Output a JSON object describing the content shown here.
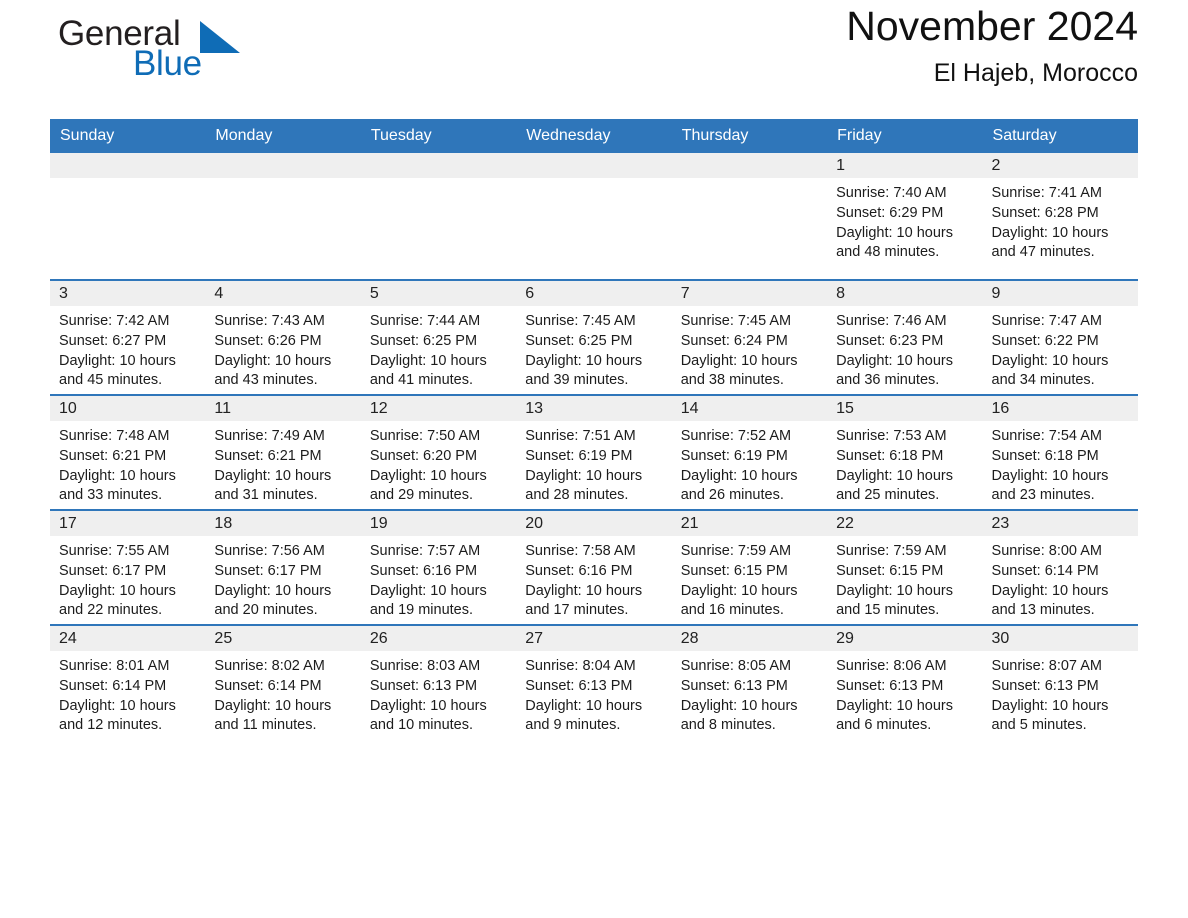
{
  "brand": {
    "name_part1": "General",
    "name_part2": "Blue",
    "flag_icon": "triangle-flag-icon",
    "accent_color": "#0f6cb6"
  },
  "header": {
    "title": "November 2024",
    "subtitle": "El Hajeb, Morocco"
  },
  "theme": {
    "header_bg": "#2f76ba",
    "daynum_bg": "#efefef",
    "text": "#1c1c1c"
  },
  "calendar": {
    "weekday_headers": [
      "Sunday",
      "Monday",
      "Tuesday",
      "Wednesday",
      "Thursday",
      "Friday",
      "Saturday"
    ],
    "weeks": [
      [
        {
          "day": "",
          "empty": true
        },
        {
          "day": "",
          "empty": true
        },
        {
          "day": "",
          "empty": true
        },
        {
          "day": "",
          "empty": true
        },
        {
          "day": "",
          "empty": true
        },
        {
          "day": "1",
          "sunrise": "Sunrise: 7:40 AM",
          "sunset": "Sunset: 6:29 PM",
          "daylight_line1": "Daylight: 10 hours",
          "daylight_line2": "and 48 minutes."
        },
        {
          "day": "2",
          "sunrise": "Sunrise: 7:41 AM",
          "sunset": "Sunset: 6:28 PM",
          "daylight_line1": "Daylight: 10 hours",
          "daylight_line2": "and 47 minutes."
        }
      ],
      [
        {
          "day": "3",
          "sunrise": "Sunrise: 7:42 AM",
          "sunset": "Sunset: 6:27 PM",
          "daylight_line1": "Daylight: 10 hours",
          "daylight_line2": "and 45 minutes."
        },
        {
          "day": "4",
          "sunrise": "Sunrise: 7:43 AM",
          "sunset": "Sunset: 6:26 PM",
          "daylight_line1": "Daylight: 10 hours",
          "daylight_line2": "and 43 minutes."
        },
        {
          "day": "5",
          "sunrise": "Sunrise: 7:44 AM",
          "sunset": "Sunset: 6:25 PM",
          "daylight_line1": "Daylight: 10 hours",
          "daylight_line2": "and 41 minutes."
        },
        {
          "day": "6",
          "sunrise": "Sunrise: 7:45 AM",
          "sunset": "Sunset: 6:25 PM",
          "daylight_line1": "Daylight: 10 hours",
          "daylight_line2": "and 39 minutes."
        },
        {
          "day": "7",
          "sunrise": "Sunrise: 7:45 AM",
          "sunset": "Sunset: 6:24 PM",
          "daylight_line1": "Daylight: 10 hours",
          "daylight_line2": "and 38 minutes."
        },
        {
          "day": "8",
          "sunrise": "Sunrise: 7:46 AM",
          "sunset": "Sunset: 6:23 PM",
          "daylight_line1": "Daylight: 10 hours",
          "daylight_line2": "and 36 minutes."
        },
        {
          "day": "9",
          "sunrise": "Sunrise: 7:47 AM",
          "sunset": "Sunset: 6:22 PM",
          "daylight_line1": "Daylight: 10 hours",
          "daylight_line2": "and 34 minutes."
        }
      ],
      [
        {
          "day": "10",
          "sunrise": "Sunrise: 7:48 AM",
          "sunset": "Sunset: 6:21 PM",
          "daylight_line1": "Daylight: 10 hours",
          "daylight_line2": "and 33 minutes."
        },
        {
          "day": "11",
          "sunrise": "Sunrise: 7:49 AM",
          "sunset": "Sunset: 6:21 PM",
          "daylight_line1": "Daylight: 10 hours",
          "daylight_line2": "and 31 minutes."
        },
        {
          "day": "12",
          "sunrise": "Sunrise: 7:50 AM",
          "sunset": "Sunset: 6:20 PM",
          "daylight_line1": "Daylight: 10 hours",
          "daylight_line2": "and 29 minutes."
        },
        {
          "day": "13",
          "sunrise": "Sunrise: 7:51 AM",
          "sunset": "Sunset: 6:19 PM",
          "daylight_line1": "Daylight: 10 hours",
          "daylight_line2": "and 28 minutes."
        },
        {
          "day": "14",
          "sunrise": "Sunrise: 7:52 AM",
          "sunset": "Sunset: 6:19 PM",
          "daylight_line1": "Daylight: 10 hours",
          "daylight_line2": "and 26 minutes."
        },
        {
          "day": "15",
          "sunrise": "Sunrise: 7:53 AM",
          "sunset": "Sunset: 6:18 PM",
          "daylight_line1": "Daylight: 10 hours",
          "daylight_line2": "and 25 minutes."
        },
        {
          "day": "16",
          "sunrise": "Sunrise: 7:54 AM",
          "sunset": "Sunset: 6:18 PM",
          "daylight_line1": "Daylight: 10 hours",
          "daylight_line2": "and 23 minutes."
        }
      ],
      [
        {
          "day": "17",
          "sunrise": "Sunrise: 7:55 AM",
          "sunset": "Sunset: 6:17 PM",
          "daylight_line1": "Daylight: 10 hours",
          "daylight_line2": "and 22 minutes."
        },
        {
          "day": "18",
          "sunrise": "Sunrise: 7:56 AM",
          "sunset": "Sunset: 6:17 PM",
          "daylight_line1": "Daylight: 10 hours",
          "daylight_line2": "and 20 minutes."
        },
        {
          "day": "19",
          "sunrise": "Sunrise: 7:57 AM",
          "sunset": "Sunset: 6:16 PM",
          "daylight_line1": "Daylight: 10 hours",
          "daylight_line2": "and 19 minutes."
        },
        {
          "day": "20",
          "sunrise": "Sunrise: 7:58 AM",
          "sunset": "Sunset: 6:16 PM",
          "daylight_line1": "Daylight: 10 hours",
          "daylight_line2": "and 17 minutes."
        },
        {
          "day": "21",
          "sunrise": "Sunrise: 7:59 AM",
          "sunset": "Sunset: 6:15 PM",
          "daylight_line1": "Daylight: 10 hours",
          "daylight_line2": "and 16 minutes."
        },
        {
          "day": "22",
          "sunrise": "Sunrise: 7:59 AM",
          "sunset": "Sunset: 6:15 PM",
          "daylight_line1": "Daylight: 10 hours",
          "daylight_line2": "and 15 minutes."
        },
        {
          "day": "23",
          "sunrise": "Sunrise: 8:00 AM",
          "sunset": "Sunset: 6:14 PM",
          "daylight_line1": "Daylight: 10 hours",
          "daylight_line2": "and 13 minutes."
        }
      ],
      [
        {
          "day": "24",
          "sunrise": "Sunrise: 8:01 AM",
          "sunset": "Sunset: 6:14 PM",
          "daylight_line1": "Daylight: 10 hours",
          "daylight_line2": "and 12 minutes."
        },
        {
          "day": "25",
          "sunrise": "Sunrise: 8:02 AM",
          "sunset": "Sunset: 6:14 PM",
          "daylight_line1": "Daylight: 10 hours",
          "daylight_line2": "and 11 minutes."
        },
        {
          "day": "26",
          "sunrise": "Sunrise: 8:03 AM",
          "sunset": "Sunset: 6:13 PM",
          "daylight_line1": "Daylight: 10 hours",
          "daylight_line2": "and 10 minutes."
        },
        {
          "day": "27",
          "sunrise": "Sunrise: 8:04 AM",
          "sunset": "Sunset: 6:13 PM",
          "daylight_line1": "Daylight: 10 hours",
          "daylight_line2": "and 9 minutes."
        },
        {
          "day": "28",
          "sunrise": "Sunrise: 8:05 AM",
          "sunset": "Sunset: 6:13 PM",
          "daylight_line1": "Daylight: 10 hours",
          "daylight_line2": "and 8 minutes."
        },
        {
          "day": "29",
          "sunrise": "Sunrise: 8:06 AM",
          "sunset": "Sunset: 6:13 PM",
          "daylight_line1": "Daylight: 10 hours",
          "daylight_line2": "and 6 minutes."
        },
        {
          "day": "30",
          "sunrise": "Sunrise: 8:07 AM",
          "sunset": "Sunset: 6:13 PM",
          "daylight_line1": "Daylight: 10 hours",
          "daylight_line2": "and 5 minutes."
        }
      ]
    ]
  }
}
